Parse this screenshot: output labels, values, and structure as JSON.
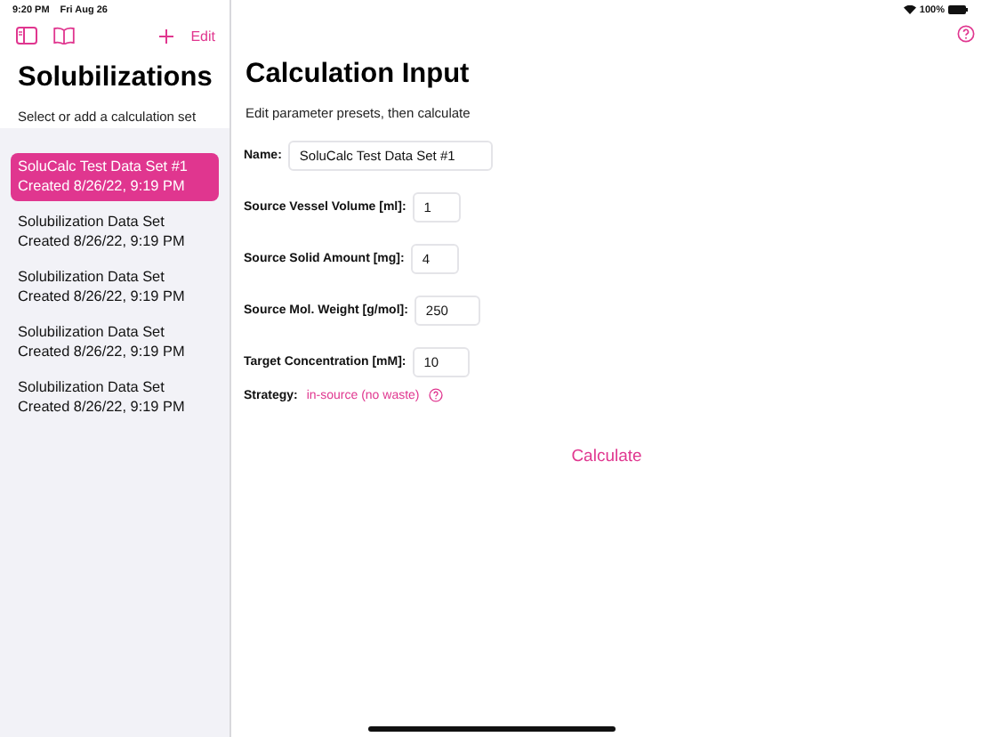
{
  "status_bar": {
    "time": "9:20 PM",
    "date": "Fri Aug 26",
    "battery": "100%"
  },
  "sidebar": {
    "title": "Solubilizations",
    "subtitle": "Select or add a calculation set",
    "edit_button": "Edit",
    "items": [
      {
        "title": "SoluCalc Test Data Set #1",
        "subtitle": "Created 8/26/22, 9:19 PM",
        "selected": true
      },
      {
        "title": "Solubilization Data Set",
        "subtitle": "Created 8/26/22, 9:19 PM",
        "selected": false
      },
      {
        "title": "Solubilization Data Set",
        "subtitle": "Created 8/26/22, 9:19 PM",
        "selected": false
      },
      {
        "title": "Solubilization Data Set",
        "subtitle": "Created 8/26/22, 9:19 PM",
        "selected": false
      },
      {
        "title": "Solubilization Data Set",
        "subtitle": "Created 8/26/22, 9:19 PM",
        "selected": false
      }
    ]
  },
  "detail": {
    "title": "Calculation Input",
    "subtitle": "Edit parameter presets, then calculate",
    "fields": [
      {
        "label": "Name:",
        "value": "SoluCalc Test Data Set #1"
      },
      {
        "label": "Source Vessel Volume [ml]:",
        "value": "1"
      },
      {
        "label": "Source Solid Amount [mg]:",
        "value": "4"
      },
      {
        "label": "Source Mol. Weight [g/mol]:",
        "value": "250"
      },
      {
        "label": "Target Concentration [mM]:",
        "value": "10"
      }
    ],
    "strategy": {
      "label": "Strategy:",
      "value": "in-source (no waste)"
    },
    "calculate_button": "Calculate"
  }
}
